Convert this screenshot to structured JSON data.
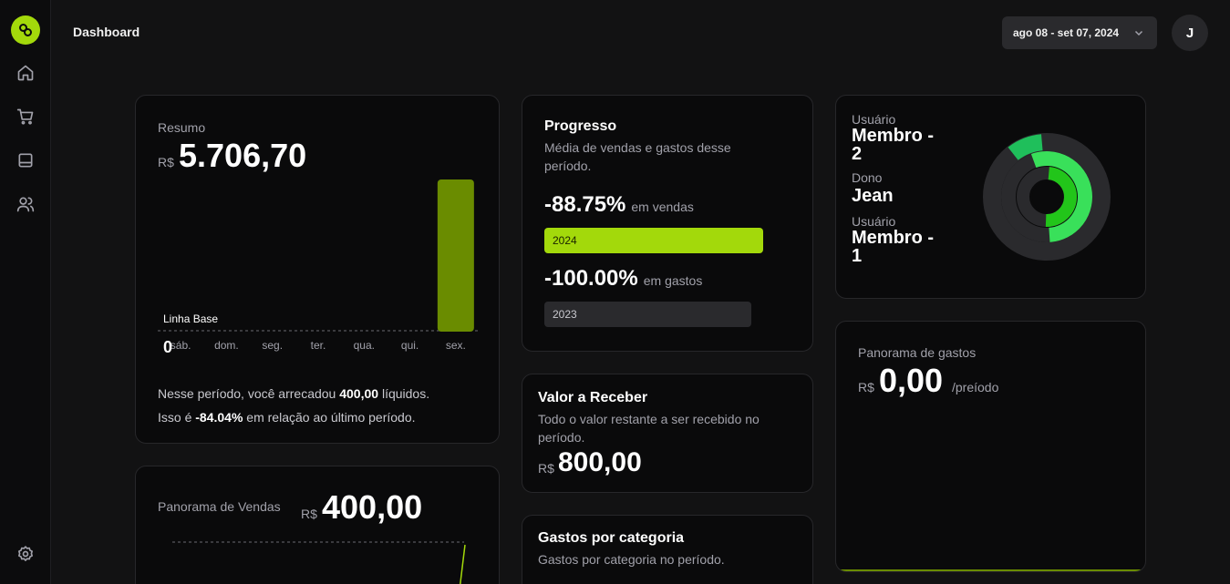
{
  "header": {
    "title": "Dashboard",
    "date_range": "ago 08 - set 07, 2024",
    "avatar_initial": "J"
  },
  "sidebar": {
    "icons": [
      "logo-icon",
      "home-icon",
      "cart-icon",
      "inbox-icon",
      "users-icon",
      "settings-icon"
    ]
  },
  "resumo": {
    "label": "Resumo",
    "currency": "R$",
    "value": "5.706,70",
    "baseline_label": "Linha Base",
    "zero_label": "0",
    "summary_prefix": "Nesse período, você arrecadou",
    "summary_amount": "400,00",
    "summary_suffix": "líquidos.",
    "compare_prefix": "Isso é",
    "compare_pct": "-84.04%",
    "compare_suffix": "em relação ao último período."
  },
  "chart_data": {
    "type": "bar",
    "categories": [
      "sáb.",
      "dom.",
      "seg.",
      "ter.",
      "qua.",
      "qui.",
      "sex."
    ],
    "values": [
      0,
      0,
      0,
      0,
      0,
      0,
      5706.7
    ],
    "bar_color": "#6a8c00"
  },
  "progresso": {
    "title": "Progresso",
    "desc": "Média de vendas e gastos desse período.",
    "sales_pct": "-88.75%",
    "sales_label": "em vendas",
    "bar1_label": "2024",
    "bar1_fill": 1.0,
    "expenses_pct": "-100.00%",
    "expenses_label": "em gastos",
    "bar2_label": "2023",
    "bar2_fill": 0.9
  },
  "valor_receber": {
    "title": "Valor a Receber",
    "desc": "Todo o valor restante a ser recebido no período.",
    "currency": "R$",
    "value": "800,00"
  },
  "gastos_categoria": {
    "title": "Gastos por categoria",
    "desc": "Gastos por categoria no período."
  },
  "usuarios": {
    "items": [
      {
        "role": "Usuário",
        "name": "Membro - 2"
      },
      {
        "role": "Dono",
        "name": "Jean"
      },
      {
        "role": "Usuário",
        "name": "Membro - 1"
      }
    ],
    "ring_colors": [
      "#1fbf5b",
      "#39e05a",
      "#22c51a"
    ]
  },
  "panorama_vendas": {
    "label": "Panorama de Vendas",
    "currency": "R$",
    "value": "400,00"
  },
  "panorama_gastos": {
    "label": "Panorama de gastos",
    "currency": "R$",
    "value": "0,00",
    "period": "/preíodo"
  },
  "colors": {
    "accent": "#a3d90b",
    "bar": "#6a8c00"
  }
}
